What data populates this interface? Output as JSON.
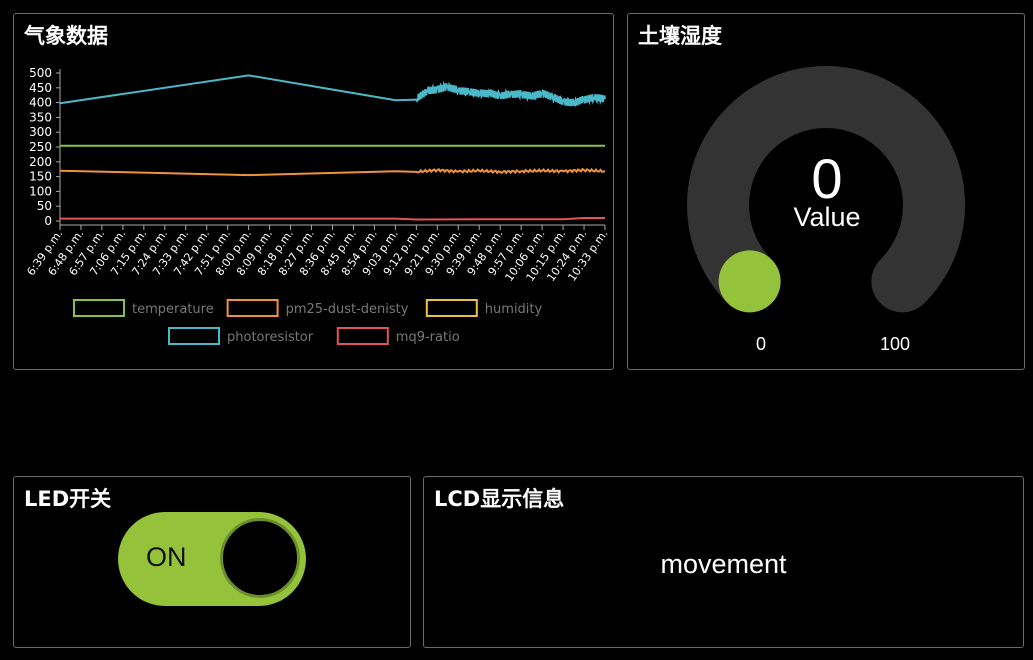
{
  "weather_panel": {
    "title": "气象数据"
  },
  "soil_panel": {
    "title": "土壤湿度",
    "value": "0",
    "value_label": "Value",
    "min_label": "0",
    "max_label": "100",
    "level": 0,
    "colors": {
      "track": "#333333",
      "indicator": "#94c23a"
    }
  },
  "led_panel": {
    "title": "LED开关",
    "toggle_label": "ON",
    "state": "on"
  },
  "lcd_panel": {
    "title": "LCD显示信息",
    "message": "movement"
  },
  "chart_data": {
    "type": "line",
    "categories": [
      "6:39 p.m.",
      "6:48 p.m.",
      "6:57 p.m.",
      "7:06 p.m.",
      "7:15 p.m.",
      "7:24 p.m.",
      "7:33 p.m.",
      "7:42 p.m.",
      "7:51 p.m.",
      "8:00 p.m.",
      "8:09 p.m.",
      "8:18 p.m.",
      "8:27 p.m.",
      "8:36 p.m.",
      "8:45 p.m.",
      "8:54 p.m.",
      "9:03 p.m.",
      "9:12 p.m.",
      "9:21 p.m.",
      "9:30 p.m.",
      "9:39 p.m.",
      "9:48 p.m.",
      "9:57 p.m.",
      "10:06 p.m.",
      "10:15 p.m.",
      "10:24 p.m.",
      "10:33 p.m."
    ],
    "yticks": [
      0,
      50,
      100,
      150,
      200,
      250,
      300,
      350,
      400,
      450,
      500
    ],
    "ylim": [
      0,
      500
    ],
    "legend": [
      {
        "name": "temperature",
        "color": "#8bc34a"
      },
      {
        "name": "pm25-dust-denisty",
        "color": "#f0923a"
      },
      {
        "name": "humidity",
        "color": "#e8c340"
      },
      {
        "name": "photoresistor",
        "color": "#4ab8c8"
      },
      {
        "name": "mq9-ratio",
        "color": "#e05555"
      }
    ],
    "series": [
      {
        "name": "temperature",
        "color": "#8bc34a",
        "points": [
          [
            0,
            254
          ],
          [
            26,
            254
          ]
        ]
      },
      {
        "name": "pm25-dust-denisty",
        "color": "#f0923a",
        "points": [
          [
            0,
            170
          ],
          [
            9,
            155
          ],
          [
            16,
            168
          ],
          [
            17,
            166
          ],
          [
            18,
            172
          ],
          [
            19,
            167
          ],
          [
            20,
            170
          ],
          [
            21,
            166
          ],
          [
            22,
            168
          ],
          [
            23,
            170
          ],
          [
            24,
            168
          ],
          [
            25,
            172
          ],
          [
            26,
            168
          ]
        ]
      },
      {
        "name": "humidity",
        "color": "#e8c340",
        "points": []
      },
      {
        "name": "photoresistor",
        "color": "#4ab8c8",
        "points": [
          [
            0,
            398
          ],
          [
            9,
            492
          ],
          [
            16,
            408
          ],
          [
            17,
            410
          ],
          [
            17.5,
            440
          ],
          [
            18,
            446
          ],
          [
            18.5,
            455
          ],
          [
            19,
            440
          ],
          [
            19.5,
            435
          ],
          [
            20,
            430
          ],
          [
            20.5,
            432
          ],
          [
            21,
            425
          ],
          [
            21.5,
            430
          ],
          [
            22,
            428
          ],
          [
            22.5,
            420
          ],
          [
            23,
            430
          ],
          [
            23.5,
            420
          ],
          [
            24,
            405
          ],
          [
            24.5,
            400
          ],
          [
            25,
            410
          ],
          [
            25.5,
            415
          ],
          [
            26,
            412
          ]
        ]
      },
      {
        "name": "mq9-ratio",
        "color": "#e05555",
        "points": [
          [
            0,
            8
          ],
          [
            16,
            8
          ],
          [
            17,
            5
          ],
          [
            20,
            6
          ],
          [
            24,
            6
          ],
          [
            25,
            10
          ],
          [
            26,
            10
          ]
        ]
      }
    ]
  }
}
